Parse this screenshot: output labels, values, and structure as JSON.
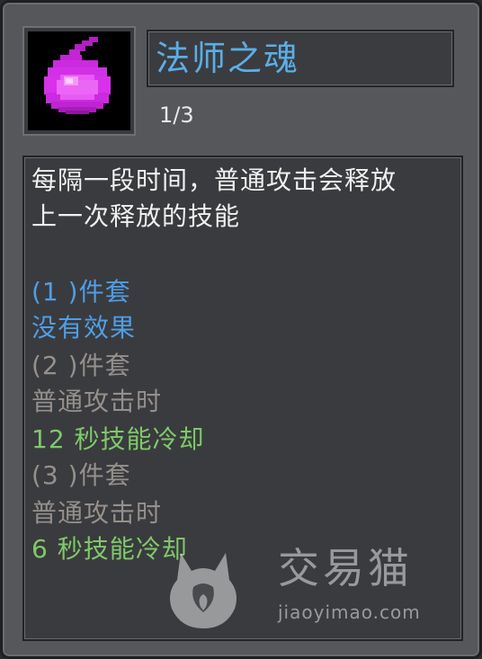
{
  "item": {
    "name": "法师之魂",
    "level": "1/3",
    "icon": "purple-soul-flame-icon",
    "name_color": "#5aaee8"
  },
  "description": {
    "lines": [
      {
        "text": "每隔一段时间，普通攻击会释放",
        "style": "white"
      },
      {
        "text": "上一次释放的技能",
        "style": "white"
      },
      {
        "text": "(1 )件套",
        "style": "blue"
      },
      {
        "text": "没有效果",
        "style": "blue"
      },
      {
        "text": "(2 )件套",
        "style": "grey"
      },
      {
        "text": "普通攻击时",
        "style": "grey"
      },
      {
        "text": "12 秒技能冷却",
        "style": "green"
      },
      {
        "text": "(3 )件套",
        "style": "grey"
      },
      {
        "text": "普通攻击时",
        "style": "grey"
      },
      {
        "text": "6 秒技能冷却",
        "style": "green"
      }
    ]
  },
  "colors": {
    "active_set": "#4f9ee6",
    "inactive_set": "#95908c",
    "bonus": "#7fc96a"
  },
  "watermark": {
    "brand": "交易猫",
    "url": "jiaoyimao.com",
    "icon": "cat-logo-icon"
  }
}
